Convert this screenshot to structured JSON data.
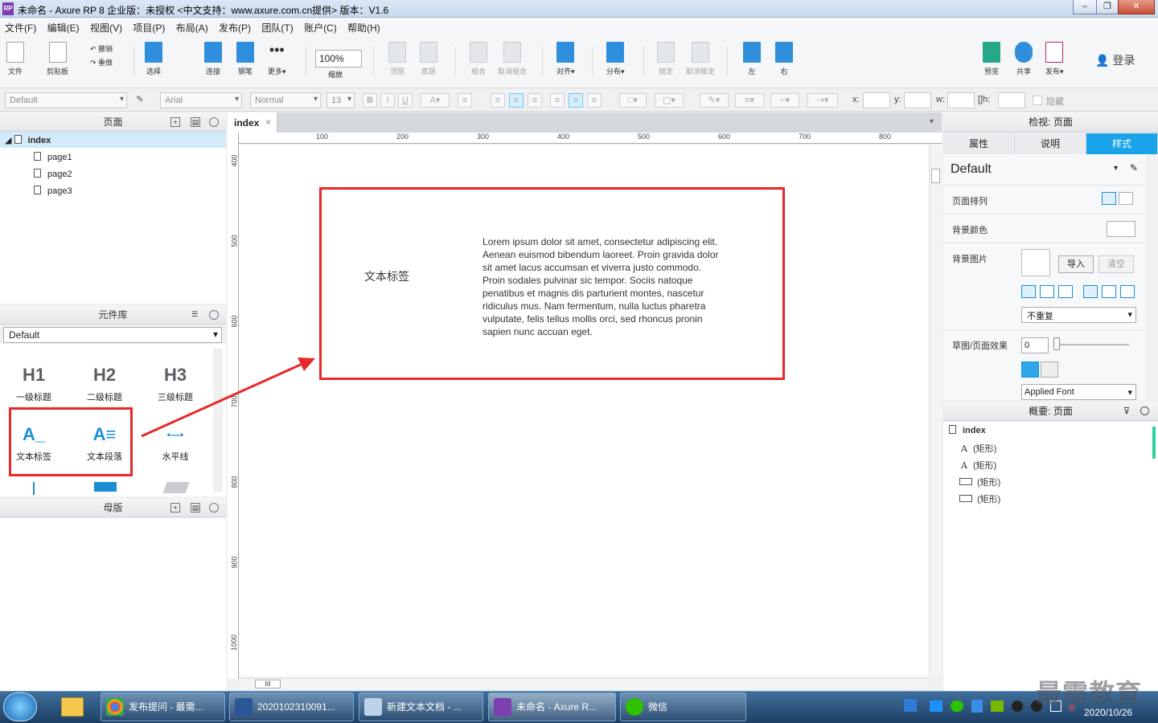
{
  "window": {
    "title": "未命名 - Axure RP 8 企业版：未授权     <中文支持：www.axure.com.cn提供> 版本：V1.6",
    "app_icon": "RP"
  },
  "menu": [
    "文件(F)",
    "编辑(E)",
    "视图(V)",
    "项目(P)",
    "布局(A)",
    "发布(P)",
    "团队(T)",
    "账户(C)",
    "帮助(H)"
  ],
  "toolbar": {
    "file": "文件",
    "clipboard": "剪贴板",
    "undo": "撤销",
    "redo": "重做",
    "select": "选择",
    "connect": "连接",
    "pen": "钢笔",
    "more": "更多▾",
    "zoom_value": "100%",
    "zoom_label": "缩放",
    "top": "顶层",
    "bottom": "底层",
    "group": "组合",
    "ungroup": "取消组合",
    "align": "对齐▾",
    "distribute": "分布▾",
    "lock": "锁定",
    "unlock": "取消锁定",
    "left": "左",
    "right": "右",
    "preview": "预览",
    "share": "共享",
    "publish": "发布▾",
    "login": "登录"
  },
  "format": {
    "style": "Default",
    "font": "Arial",
    "weight": "Normal",
    "size": "13",
    "x": "x:",
    "y": "y:",
    "w": "w:",
    "h": "h:",
    "hidden": "隐藏"
  },
  "pages_panel": {
    "title": "页面",
    "pages": [
      "index",
      "page1",
      "page2",
      "page3"
    ]
  },
  "library_panel": {
    "title": "元件库",
    "selected": "Default",
    "items": [
      {
        "glyph": "H1",
        "label": "一级标题"
      },
      {
        "glyph": "H2",
        "label": "二级标题"
      },
      {
        "glyph": "H3",
        "label": "三级标题"
      },
      {
        "glyph": "A_",
        "label": "文本标签"
      },
      {
        "glyph": "A≡",
        "label": "文本段落"
      },
      {
        "glyph": "•—•",
        "label": "水平线"
      }
    ]
  },
  "masters_panel": {
    "title": "母版"
  },
  "canvas": {
    "tab": "index",
    "ruler_top": [
      "100",
      "200",
      "300",
      "400",
      "500",
      "600",
      "700",
      "800"
    ],
    "ruler_left": [
      "400",
      "500",
      "600",
      "700",
      "800",
      "900",
      "1000"
    ],
    "text_label": "文本标签",
    "paragraph": "Lorem ipsum dolor sit amet, consectetur adipiscing elit. Aenean euismod bibendum laoreet. Proin gravida dolor sit amet lacus accumsan et viverra justo commodo. Proin sodales pulvinar sic tempor. Sociis natoque penatibus et magnis dis parturient montes, nascetur ridiculus mus. Nam fermentum, nulla luctus pharetra vulputate, felis tellus mollis orci, sed rhoncus pronin sapien nunc accuan eget.",
    "hscroll_label": "III"
  },
  "inspector": {
    "title": "检视: 页面",
    "tabs": [
      "属性",
      "说明",
      "样式"
    ],
    "style_name": "Default",
    "page_align": "页面排列",
    "bg_color": "背景颜色",
    "bg_image": "背景图片",
    "import": "导入",
    "clear": "清空",
    "repeat": "不重复",
    "sketch": "草图/页面效果",
    "sketch_value": "0",
    "font_select": "Applied Font"
  },
  "overview": {
    "title": "概要: 页面",
    "root": "index",
    "items": [
      "(矩形)",
      "(矩形)",
      "(矩形)",
      "(矩形)"
    ]
  },
  "taskbar": {
    "tasks": [
      "发布提问 - 最需...",
      "2020102310091...",
      "新建文本文档 - ...",
      "未命名 - Axure R...",
      "微信"
    ],
    "date": "2020/10/26"
  },
  "watermark": "最需教育",
  "colors": {
    "accent": "#1aa3e8",
    "highlight_red": "#e8282a",
    "taskbar": "#1d3f66"
  }
}
